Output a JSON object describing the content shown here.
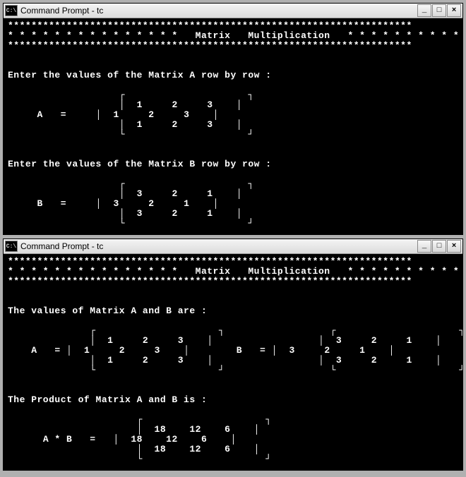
{
  "window1": {
    "title": "Command Prompt - tc",
    "header_stars_top": "*********************************************************************",
    "header_line": "* * * * * * * * * * * * * * *   Matrix   Multiplication   * * * * * * * * * * * * * * *",
    "header_stars_bottom": "*********************************************************************",
    "prompt_a": "Enter the values of the Matrix A row by row :",
    "a_label": "A   =",
    "a_row1": "1     2     3",
    "a_row2": "1     2     3",
    "a_row3": "1     2     3",
    "prompt_b": "Enter the values of the Matrix B row by row :",
    "b_label": "B   =",
    "b_row1": "3     2     1",
    "b_row2": "3     2     1",
    "b_row3": "3     2     1"
  },
  "window2": {
    "title": "Command Prompt - tc",
    "header_stars_top": "*********************************************************************",
    "header_line": "* * * * * * * * * * * * * * *   Matrix   Multiplication   * * * * * * * * * * * * * * *",
    "header_stars_bottom": "*********************************************************************",
    "values_header": "The values of Matrix A and B are :",
    "a_label": "A   =",
    "a_row1": "1     2     3",
    "a_row2": "1     2     3",
    "a_row3": "1     2     3",
    "b_label": "B   =",
    "b_row1": "3     2     1",
    "b_row2": "3     2     1",
    "b_row3": "3     2     1",
    "product_header": "The Product of Matrix A and B is :",
    "ab_label": "A * B   =",
    "p_row1": "18    12    6",
    "p_row2": "18    12    6",
    "p_row3": "18    12    6"
  },
  "controls": {
    "minimize": "_",
    "maximize": "□",
    "close": "×"
  },
  "chart_data": {
    "type": "table",
    "title": "Matrix Multiplication",
    "matrices": {
      "A": [
        [
          1,
          2,
          3
        ],
        [
          1,
          2,
          3
        ],
        [
          1,
          2,
          3
        ]
      ],
      "B": [
        [
          3,
          2,
          1
        ],
        [
          3,
          2,
          1
        ],
        [
          3,
          2,
          1
        ]
      ],
      "product": [
        [
          18,
          12,
          6
        ],
        [
          18,
          12,
          6
        ],
        [
          18,
          12,
          6
        ]
      ]
    }
  }
}
